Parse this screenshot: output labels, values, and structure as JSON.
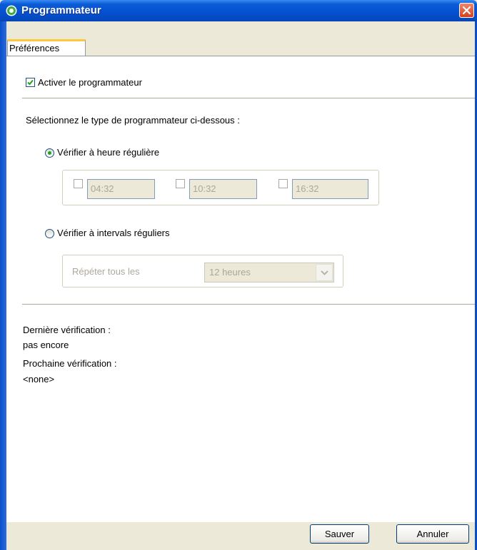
{
  "window": {
    "title": "Programmateur",
    "tab_label": "Préférences"
  },
  "enable": {
    "label": "Activer le programmateur",
    "checked": true
  },
  "select_type_label": "Sélectionnez le type de programmateur ci-dessous :",
  "regular_time": {
    "label": "Vérifier à heure régulière",
    "selected": true,
    "times": [
      "04:32",
      "10:32",
      "16:32"
    ]
  },
  "regular_interval": {
    "label": "Vérifier à intervals réguliers",
    "selected": false,
    "repeat_label": "Répéter tous les",
    "repeat_value": "12 heures"
  },
  "status": {
    "last_label": "Dernière vérification :",
    "last_value": "pas encore",
    "next_label": "Prochaine vérification :",
    "next_value": "<none>"
  },
  "buttons": {
    "save": "Sauver",
    "cancel": "Annuler"
  },
  "colors": {
    "titlebar": "#0550D0",
    "close": "#D4401F",
    "check": "#21A121"
  }
}
